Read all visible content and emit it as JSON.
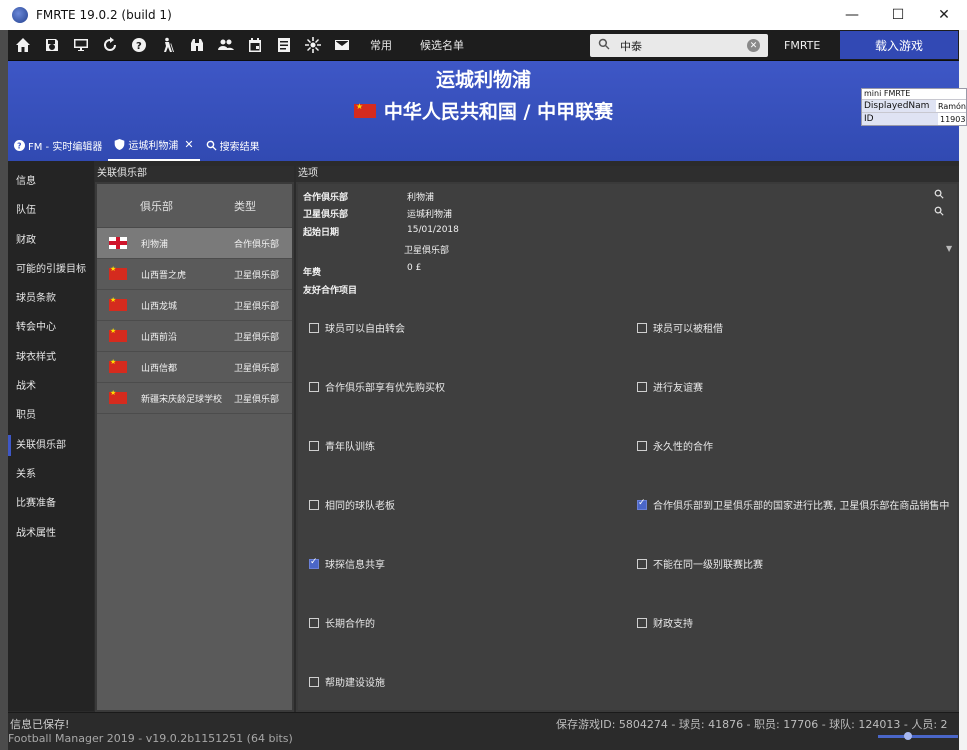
{
  "window": {
    "title": "FMRTE 19.0.2 (build 1)",
    "minimize": "—",
    "maximize": "☐",
    "close": "✕"
  },
  "toolbar": {
    "icons": [
      "home-icon",
      "save-icon",
      "monitor-icon",
      "refresh-icon",
      "help-icon",
      "scout-icon",
      "binoculars-icon",
      "people-icon",
      "calendar-icon",
      "notes-icon",
      "settings-icon",
      "mail-icon"
    ],
    "common_label": "常用",
    "shortlist_label": "候选名单",
    "search_value": "中泰",
    "fmrte_label": "FMRTE",
    "load_game_label": "载入游戏"
  },
  "header": {
    "club_name": "运城利物浦",
    "league": "中华人民共和国 / 中甲联赛",
    "tabs": [
      {
        "label": "FM - 实时编辑器"
      },
      {
        "label": "运城利物浦",
        "active": true
      },
      {
        "label": "搜索结果"
      }
    ]
  },
  "mini_fmrte": {
    "title": "mini FMRTE",
    "rows": [
      {
        "key": "DisplayedNam",
        "value": "Ramón"
      },
      {
        "key": "ID",
        "value": "11903"
      }
    ]
  },
  "sidebar": {
    "items": [
      {
        "label": "信息"
      },
      {
        "label": "队伍"
      },
      {
        "label": "财政"
      },
      {
        "label": "可能的引援目标"
      },
      {
        "label": "球员条款"
      },
      {
        "label": "转会中心"
      },
      {
        "label": "球衣样式"
      },
      {
        "label": "战术"
      },
      {
        "label": "职员"
      },
      {
        "label": "关联俱乐部",
        "active": true
      },
      {
        "label": "关系"
      },
      {
        "label": "比赛准备"
      },
      {
        "label": "战术属性"
      }
    ]
  },
  "related_clubs": {
    "title": "关联俱乐部",
    "columns": [
      "俱乐部",
      "类型"
    ],
    "rows": [
      {
        "flag": "england",
        "name": "利物浦",
        "type": "合作俱乐部"
      },
      {
        "flag": "china",
        "name": "山西晋之虎",
        "type": "卫星俱乐部"
      },
      {
        "flag": "china",
        "name": "山西龙城",
        "type": "卫星俱乐部"
      },
      {
        "flag": "china",
        "name": "山西前沿",
        "type": "卫星俱乐部"
      },
      {
        "flag": "china",
        "name": "山西信都",
        "type": "卫星俱乐部"
      },
      {
        "flag": "china",
        "name": "新疆宋庆龄足球学校",
        "type": "卫星俱乐部"
      }
    ]
  },
  "options": {
    "title": "选项",
    "fields": {
      "parent_label": "合作俱乐部",
      "parent_value": "利物浦",
      "satellite_label": "卫星俱乐部",
      "satellite_value": "运城利物浦",
      "start_label": "起始日期",
      "start_value": "15/01/2018",
      "type_value": "卫星俱乐部",
      "fee_label": "年费",
      "fee_value": "0 £",
      "items_label": "友好合作项目"
    },
    "checkboxes_left": [
      {
        "label": "球员可以自由转会",
        "checked": false
      },
      {
        "label": "合作俱乐部享有优先购买权",
        "checked": false
      },
      {
        "label": "青年队训练",
        "checked": false
      },
      {
        "label": "相同的球队老板",
        "checked": false
      },
      {
        "label": "球探信息共享",
        "checked": true
      },
      {
        "label": "长期合作的",
        "checked": false
      },
      {
        "label": "帮助建设设施",
        "checked": false
      }
    ],
    "checkboxes_right": [
      {
        "label": "球员可以被租借",
        "checked": false
      },
      {
        "label": "进行友谊赛",
        "checked": false
      },
      {
        "label": "永久性的合作",
        "checked": false
      },
      {
        "label": "合作俱乐部到卫星俱乐部的国家进行比赛, 卫星俱乐部在商品销售中",
        "checked": true
      },
      {
        "label": "不能在同一级别联赛比赛",
        "checked": false
      },
      {
        "label": "财政支持",
        "checked": false
      }
    ]
  },
  "status": {
    "saved": "信息已保存!",
    "version": "Football Manager 2019 - v19.0.2b1151251 (64 bits)",
    "stats": "保存游戏ID: 5804274 - 球员: 41876 - 职员: 17706 - 球队: 124013 - 人员: 2"
  },
  "colors": {
    "accent": "#3e57c6",
    "background": "#2b2b2b",
    "panel": "#3a3a3a"
  }
}
